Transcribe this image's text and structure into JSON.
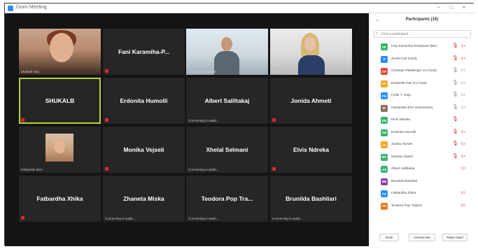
{
  "window": {
    "title": "Zoom Meeting",
    "minimize": "–",
    "maximize": "□",
    "close": "×"
  },
  "tiles": [
    {
      "id": "t1",
      "type": "photo-woman1",
      "caption": "Shukalb Hyd."
    },
    {
      "id": "t2",
      "type": "name",
      "name": "Fani Karamiha-P..."
    },
    {
      "id": "t3",
      "type": "photo-man",
      "caption": "Christian Pleitberger"
    },
    {
      "id": "t4",
      "type": "photo-woman2",
      "caption": "Fjolle Y. Hoja"
    },
    {
      "id": "t5",
      "type": "name",
      "name": "SHUKALB",
      "active": true
    },
    {
      "id": "t6",
      "type": "name",
      "name": "Erdonita Humolli"
    },
    {
      "id": "t7",
      "type": "name",
      "name": "Albert Saliltakaj",
      "status": "Connecting to audio..."
    },
    {
      "id": "t8",
      "type": "name",
      "name": "Jonida Ahmeti"
    },
    {
      "id": "t9",
      "type": "photo-interp",
      "caption": "Interpreter ESA"
    },
    {
      "id": "t10",
      "type": "name",
      "name": "Monika Vejseli"
    },
    {
      "id": "t11",
      "type": "name",
      "name": "Xhelal Selmani",
      "status": "Connecting to audio..."
    },
    {
      "id": "t12",
      "type": "name",
      "name": "Elvis Ndreka"
    },
    {
      "id": "t13",
      "type": "name",
      "name": "Fatbardha Xhika"
    },
    {
      "id": "t14",
      "type": "name",
      "name": "Zhaneta Miska",
      "status": "Connecting to audio..."
    },
    {
      "id": "t15",
      "type": "name",
      "name": "Teodora Pop Tra...",
      "status": "Connecting to audio..."
    },
    {
      "id": "t16",
      "type": "name",
      "name": "Brunilda Bashliari",
      "status": "Connecting to audio..."
    }
  ],
  "panel": {
    "collapse": "⌄",
    "title": "Participants (16)",
    "search_placeholder": "Find a participant",
    "participants": [
      {
        "initials": "FK",
        "color": "#3cb371",
        "name": "Fani Karamiha-Pelopanie (Me)",
        "mic": "muted",
        "cam": "off"
      },
      {
        "initials": "S",
        "color": "#2d8cff",
        "name": "SHUKALB (Host)",
        "mic": "muted",
        "cam": "off"
      },
      {
        "initials": "CP",
        "color": "#e04a3c",
        "name": "Christian Pleitberger (Co-host)",
        "mic": "on",
        "cam": "on"
      },
      {
        "initials": "EP",
        "color": "#f5a623",
        "name": "Eisabella Pari (Co-host)",
        "mic": "on",
        "cam": "on"
      },
      {
        "initials": "FH",
        "color": "#2d8cff",
        "name": "Fjolle Y. Hoja",
        "mic": "on",
        "cam": "on"
      },
      {
        "initials": "IE",
        "color": "#8e6e5a",
        "name": "Interpreter ESA (Interpreter)",
        "mic": "on",
        "cam": "on"
      },
      {
        "initials": "EN",
        "color": "#3cb371",
        "name": "Elvis Ndreka",
        "mic": "muted",
        "cam": "none"
      },
      {
        "initials": "EH",
        "color": "#3cb371",
        "name": "Erdonita Humolli",
        "mic": "muted",
        "cam": "off"
      },
      {
        "initials": "JA",
        "color": "#f5a623",
        "name": "Jonida Ahmeti",
        "mic": "muted",
        "cam": "off"
      },
      {
        "initials": "MV",
        "color": "#3cb371",
        "name": "Monika Vejseli",
        "mic": "muted",
        "cam": "off"
      },
      {
        "initials": "AS",
        "color": "#3cb371",
        "name": "Albert Saliltakaj",
        "mic": "none",
        "cam": "off"
      },
      {
        "initials": "BB",
        "color": "#8e44ad",
        "name": "Brunilda Bashliari",
        "mic": "none",
        "cam": "none"
      },
      {
        "initials": "FX",
        "color": "#2d8cff",
        "name": "Fatbardha Xhika",
        "mic": "none",
        "cam": "off"
      },
      {
        "initials": "TP",
        "color": "#e67e22",
        "name": "Teodora Pop Trajkov",
        "mic": "none",
        "cam": "off"
      }
    ],
    "footer": {
      "invite": "Invite",
      "unmute": "Unmute Me",
      "raise": "Raise Hand"
    }
  }
}
